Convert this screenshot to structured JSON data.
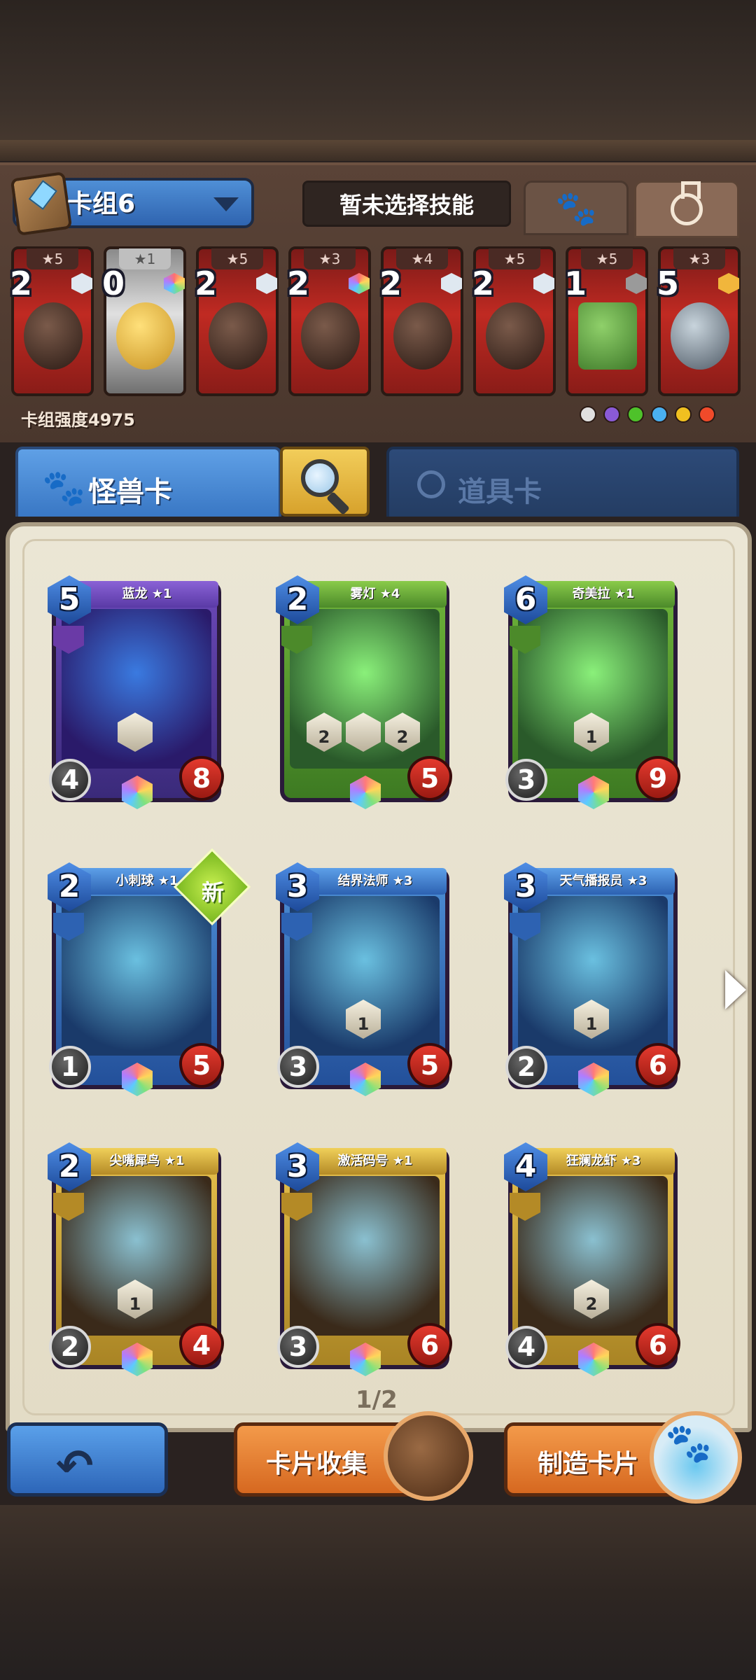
{
  "deck": {
    "name": "卡组6",
    "skill_text": "暂未选择技能",
    "power_label": "卡组强度4975",
    "slots": [
      {
        "stars": "★5",
        "cost": "2",
        "gem": "white",
        "art": "red-demon-helmet"
      },
      {
        "stars": "★1",
        "cost": "0",
        "gem": "rainbow",
        "art": "gold-coin"
      },
      {
        "stars": "★5",
        "cost": "2",
        "gem": "white",
        "art": "dark-armor"
      },
      {
        "stars": "★3",
        "cost": "2",
        "gem": "rainbow",
        "art": "gold-boots"
      },
      {
        "stars": "★4",
        "cost": "2",
        "gem": "white",
        "art": "dark-greaves"
      },
      {
        "stars": "★5",
        "cost": "2",
        "gem": "white",
        "art": "bull-gauntlet"
      },
      {
        "stars": "★5",
        "cost": "1",
        "gem": "grey",
        "art": "green-tunic"
      },
      {
        "stars": "★3",
        "cost": "5",
        "gem": "gold",
        "art": "steel-helmet"
      }
    ]
  },
  "tabs": {
    "monster": "怪兽卡",
    "item": "道具卡"
  },
  "cards": [
    {
      "name": "蓝龙 ★1",
      "cost": "5",
      "atk": "4",
      "hp": "8",
      "color": "purple",
      "skills": [
        ""
      ],
      "new": false
    },
    {
      "name": "雾灯 ★4",
      "cost": "2",
      "atk": "",
      "hp": "5",
      "color": "green",
      "skills": [
        "2",
        "",
        "2"
      ],
      "new": false
    },
    {
      "name": "奇美拉 ★1",
      "cost": "6",
      "atk": "3",
      "hp": "9",
      "color": "green",
      "skills": [
        "1"
      ],
      "new": false
    },
    {
      "name": "小刺球 ★1",
      "cost": "2",
      "atk": "1",
      "hp": "5",
      "color": "blue",
      "skills": [],
      "new": true
    },
    {
      "name": "结界法师 ★3",
      "cost": "3",
      "atk": "3",
      "hp": "5",
      "color": "blue",
      "skills": [
        "1"
      ],
      "new": false
    },
    {
      "name": "天气播报员 ★3",
      "cost": "3",
      "atk": "2",
      "hp": "6",
      "color": "blue",
      "skills": [
        "1"
      ],
      "new": false
    },
    {
      "name": "尖嘴犀鸟 ★1",
      "cost": "2",
      "atk": "2",
      "hp": "4",
      "color": "gold",
      "skills": [
        "1"
      ],
      "new": false
    },
    {
      "name": "激活码号 ★1",
      "cost": "3",
      "atk": "3",
      "hp": "6",
      "color": "gold",
      "skills": [],
      "new": false
    },
    {
      "name": "狂澜龙虾 ★3",
      "cost": "4",
      "atk": "4",
      "hp": "6",
      "color": "gold",
      "skills": [
        "2"
      ],
      "new": false
    }
  ],
  "new_badge_label": "新",
  "pagination": "1/2",
  "buttons": {
    "collection": "卡片收集",
    "craft": "制造卡片"
  },
  "faction_colors": [
    "#e0e0e0",
    "#8a5ad6",
    "#4ec22a",
    "#4ab0f0",
    "#f0c020",
    "#f04a2a"
  ]
}
